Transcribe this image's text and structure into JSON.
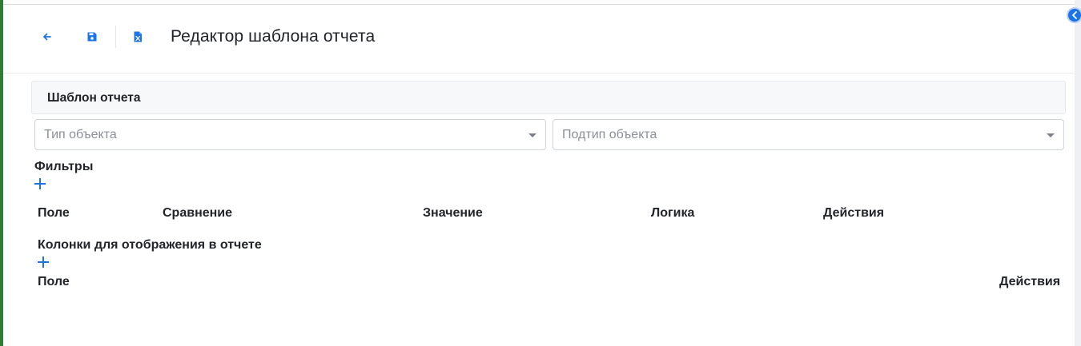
{
  "header": {
    "title": "Редактор шаблона отчета",
    "icons": [
      "arrow-left-icon",
      "save-icon",
      "excel-file-icon"
    ]
  },
  "template_section": {
    "title": "Шаблон отчета"
  },
  "object_type": {
    "placeholder": "Тип объекта"
  },
  "object_subtype": {
    "placeholder": "Подтип объекта"
  },
  "filters": {
    "title": "Фильтры",
    "columns": [
      "Поле",
      "Сравнение",
      "Значение",
      "Логика",
      "Действия"
    ]
  },
  "report_columns": {
    "title": "Колонки для отображения в отчете",
    "columns": [
      "Поле",
      "Действия"
    ]
  },
  "colors": {
    "accent": "#1a73e8",
    "left_bar": "#2e7d32"
  }
}
